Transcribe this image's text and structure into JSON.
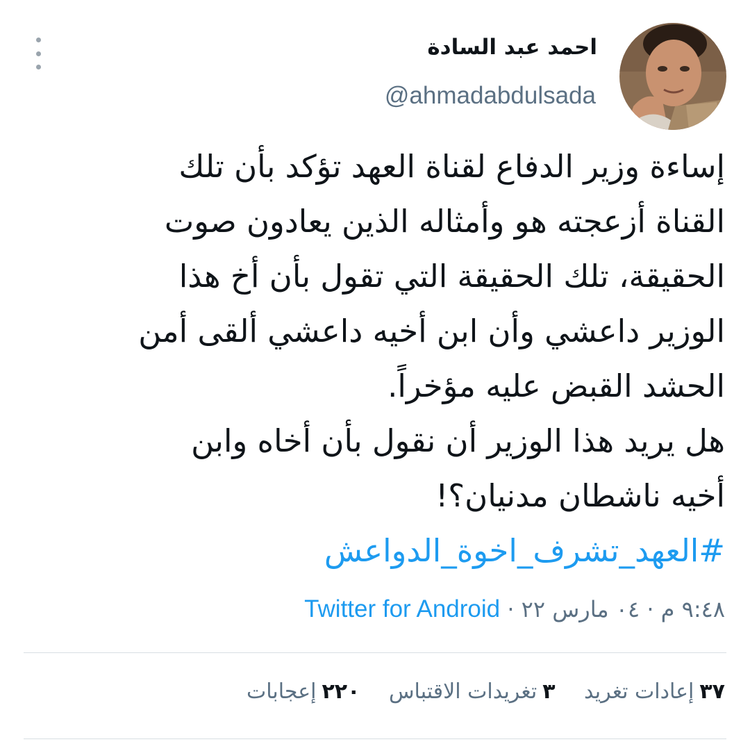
{
  "author": {
    "display_name": "احمد عبد السادة",
    "handle": "@ahmadabdulsada",
    "avatar_icon": "profile-photo"
  },
  "tweet": {
    "lines": [
      "إساءة وزير الدفاع لقناة العهد تؤكد بأن تلك",
      "القناة أزعجته هو وأمثاله الذين يعادون صوت",
      "الحقيقة، تلك الحقيقة التي تقول بأن أخ هذا",
      "الوزير داعشي وأن ابن أخيه داعشي ألقى أمن",
      "الحشد القبض عليه مؤخراً.",
      "هل يريد هذا الوزير أن نقول بأن أخاه وابن",
      "أخيه ناشطان مدنيان؟!"
    ],
    "hashtag": "#العهد_تشرف_اخوة_الدواعش"
  },
  "meta": {
    "time": "٩:٤٨ م",
    "date": "٠٤ مارس ٢٢",
    "separator": "·",
    "source": "Twitter for Android"
  },
  "stats": {
    "retweets_count": "٣٧",
    "retweets_label": "إعادات تغريد",
    "quotes_count": "٣",
    "quotes_label": "تغريدات الاقتباس",
    "likes_count": "٢٢٠",
    "likes_label": "إعجابات"
  },
  "colors": {
    "link": "#1d9bf0",
    "secondary_text": "#5b7083",
    "primary_text": "#0f1419",
    "divider": "#d8dee3"
  }
}
